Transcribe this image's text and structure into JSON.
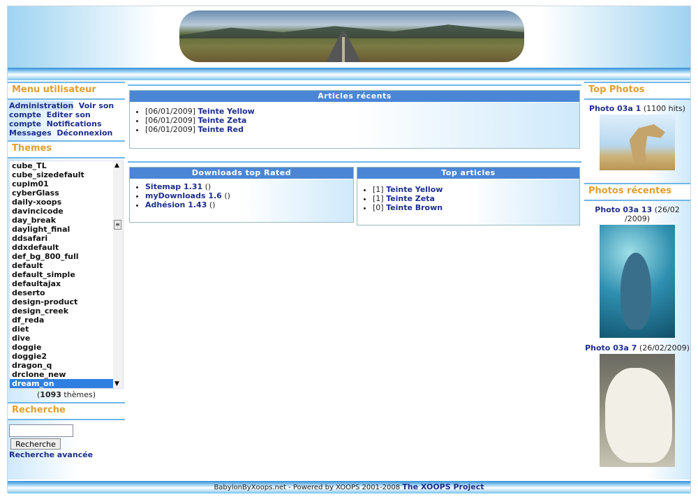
{
  "user_menu": {
    "title": "Menu utilisateur",
    "links": [
      "Administration",
      "Voir son compte",
      "Editer son compte",
      "Notifications",
      "Messages",
      "Déconnexion"
    ]
  },
  "themes": {
    "title": "Themes",
    "items": [
      "cube_TL",
      "cube_sizedefault",
      "cupim01",
      "cyberGlass",
      "daily-xoops",
      "davincicode",
      "day_break",
      "daylight_final",
      "ddsafari",
      "ddxdefault",
      "def_bg_800_full",
      "default",
      "default_simple",
      "defaultajax",
      "deserto",
      "design-product",
      "design_creek",
      "df_reda",
      "diet",
      "dive",
      "doggie",
      "doggie2",
      "dragon_q",
      "drclone_new",
      "dream_on"
    ],
    "selected": "dream_on",
    "count_num": "1093",
    "count_label": "thèmes"
  },
  "search": {
    "title": "Recherche",
    "value": "",
    "button": "Recherche",
    "advanced": "Recherche avancée"
  },
  "recent_articles": {
    "title": "Articles récents",
    "items": [
      {
        "date": "[06/01/2009]",
        "title": "Teinte Yellow"
      },
      {
        "date": "[06/01/2009]",
        "title": "Teinte Zeta"
      },
      {
        "date": "[06/01/2009]",
        "title": "Teinte Red"
      }
    ]
  },
  "downloads": {
    "title": "Downloads top Rated",
    "items": [
      {
        "name": "Sitemap 1.31",
        "rating": "()"
      },
      {
        "name": "myDownloads 1.6",
        "rating": "()"
      },
      {
        "name": "Adhésion 1.43",
        "rating": "()"
      }
    ]
  },
  "top_articles": {
    "title": "Top articles",
    "items": [
      {
        "count": "[1]",
        "title": "Teinte Yellow"
      },
      {
        "count": "[1]",
        "title": "Teinte Zeta"
      },
      {
        "count": "[0]",
        "title": "Teinte Brown"
      }
    ]
  },
  "top_photos": {
    "title": "Top Photos",
    "photo_title": "Photo 03a 1",
    "photo_meta": "(1100 hits)"
  },
  "recent_photos": {
    "title": "Photos récentes",
    "items": [
      {
        "title": "Photo 03a 13",
        "date": "(26/02 /2009)"
      },
      {
        "title": "Photo 03a 7",
        "date": "(26/02/2009)"
      }
    ]
  },
  "footer": {
    "text": "BabylonByXoops.net - Powered by XOOPS 2001-2008",
    "link": "The XOOPS Project"
  },
  "colors": {
    "accent": "#4b86d6",
    "block_title": "#e0a030",
    "link": "#1d2e8c"
  }
}
